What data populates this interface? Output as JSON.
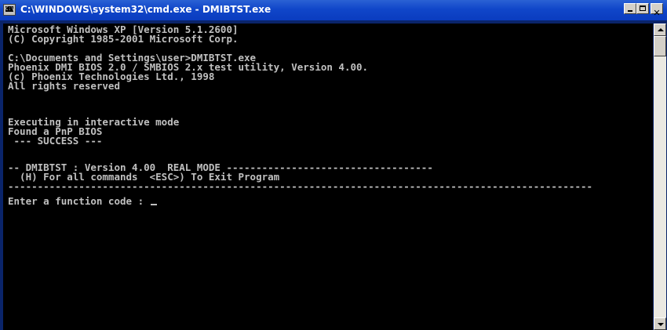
{
  "window": {
    "title": "C:\\WINDOWS\\system32\\cmd.exe - DMIBTST.exe",
    "icon_glyph": "C:\\",
    "controls": {
      "minimize": "minimize-icon",
      "maximize": "maximize-icon",
      "close": "close-icon",
      "close_glyph": "✕"
    }
  },
  "console": {
    "lines": [
      "Microsoft Windows XP [Version 5.1.2600]",
      "(C) Copyright 1985-2001 Microsoft Corp.",
      "",
      "C:\\Documents and Settings\\user>DMIBTST.exe",
      "Phoenix DMI BIOS 2.0 / SMBIOS 2.x test utility, Version 4.00.",
      "(c) Phoenix Technologies Ltd., 1998",
      "All rights reserved",
      "",
      "",
      "Executing in interactive mode",
      "Found a PnP BIOS",
      " --- SUCCESS ---",
      "",
      "-- DMIBTST : Version 4.00  REAL MODE -----------------------------------",
      "  (H) For all commands  <ESC>) To Exit Program",
      "---------------------------------------------------------------------------------------------------",
      "Enter a function code : "
    ]
  },
  "colors": {
    "titlebar": "#0a3cbf",
    "console_bg": "#000000",
    "console_fg": "#c0c0c0"
  }
}
